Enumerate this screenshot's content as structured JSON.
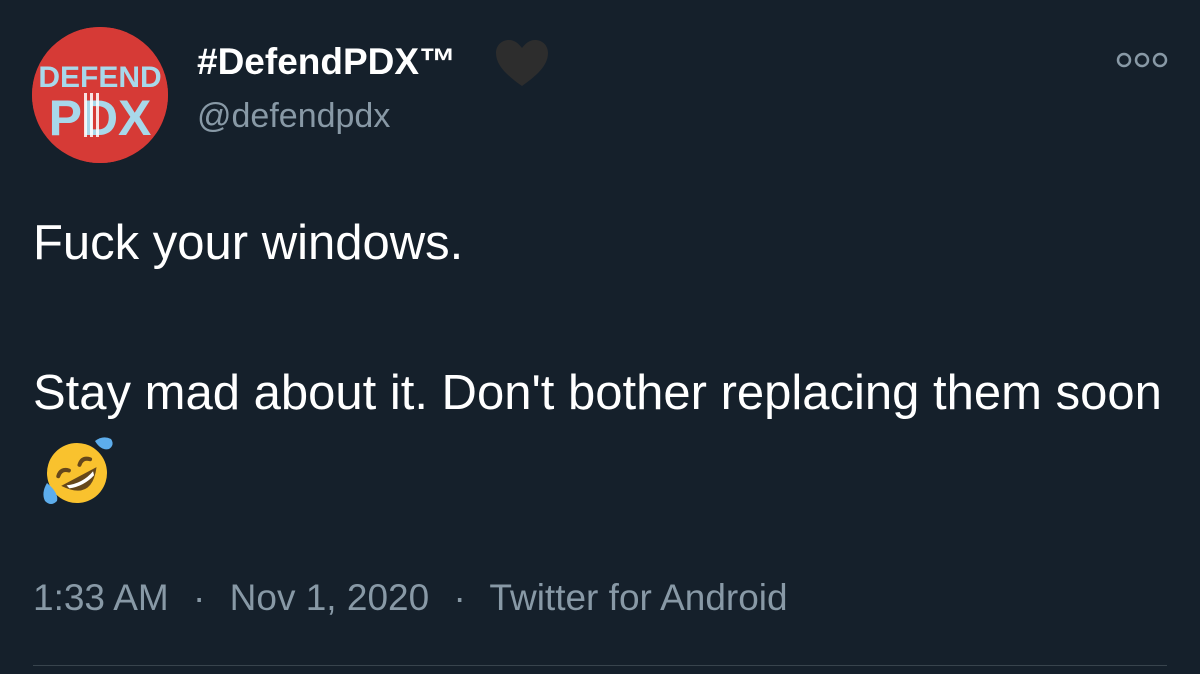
{
  "tweet": {
    "author": {
      "display_name": "#DefendPDX™",
      "handle": "@defendpdx",
      "avatar_text_top": "DEFEND",
      "avatar_text_bottom": "PDX",
      "name_emoji": "black-heart-icon"
    },
    "text_line_1": "Fuck your windows.",
    "text_line_2": "Stay mad about it. Don't bother replacing them soon",
    "text_emoji": "rolling-on-floor-laughing-emoji",
    "time": "1:33 AM",
    "date": "Nov 1, 2020",
    "separator": "·",
    "source": "Twitter for Android"
  },
  "colors": {
    "background": "#15202b",
    "secondary_text": "#8899a6",
    "avatar_red": "#d63a36",
    "divider": "#38444d"
  },
  "icons": {
    "more": "more-options-icon"
  }
}
